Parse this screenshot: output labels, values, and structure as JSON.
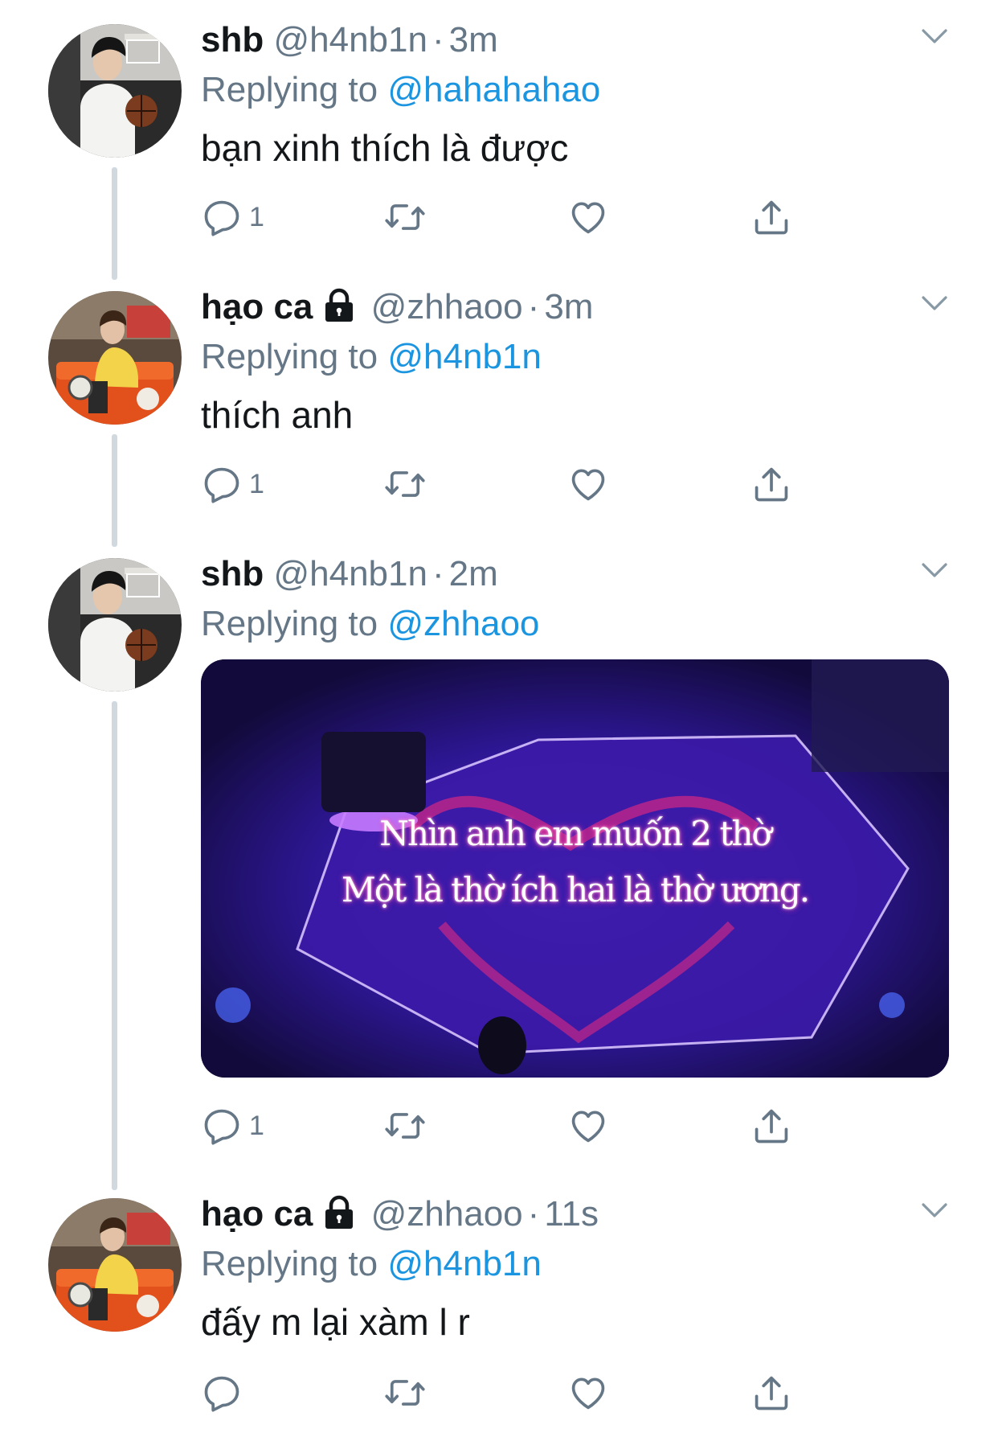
{
  "tweets": [
    {
      "name": "shb",
      "handle": "@h4nb1n",
      "time": "3m",
      "replying_prefix": "Replying to",
      "replying_to": "@hahahahao",
      "text": "bạn xinh thích là được",
      "reply_count": "1",
      "locked": false
    },
    {
      "name": "hạo ca",
      "handle": "@zhhaoo",
      "time": "3m",
      "replying_prefix": "Replying to",
      "replying_to": "@h4nb1n",
      "text": "thích anh",
      "reply_count": "1",
      "locked": true
    },
    {
      "name": "shb",
      "handle": "@h4nb1n",
      "time": "2m",
      "replying_prefix": "Replying to",
      "replying_to": "@zhhaoo",
      "media_caption_line1": "Nhìn anh em muốn 2 thờ",
      "media_caption_line2": "Một là thờ ích hai là thờ ương.",
      "reply_count": "1",
      "locked": false
    },
    {
      "name": "hạo ca",
      "handle": "@zhhaoo",
      "time": "11s",
      "replying_prefix": "Replying to",
      "replying_to": "@h4nb1n",
      "text": "đấy m lại xàm l r",
      "reply_count": "",
      "locked": true
    }
  ],
  "icons": [
    "reply-icon",
    "retweet-icon",
    "like-icon",
    "share-icon",
    "chevron-down-icon",
    "lock-icon"
  ],
  "colors": {
    "link": "#1b95e0",
    "muted": "#657786",
    "thread_line": "#cfd9de"
  }
}
